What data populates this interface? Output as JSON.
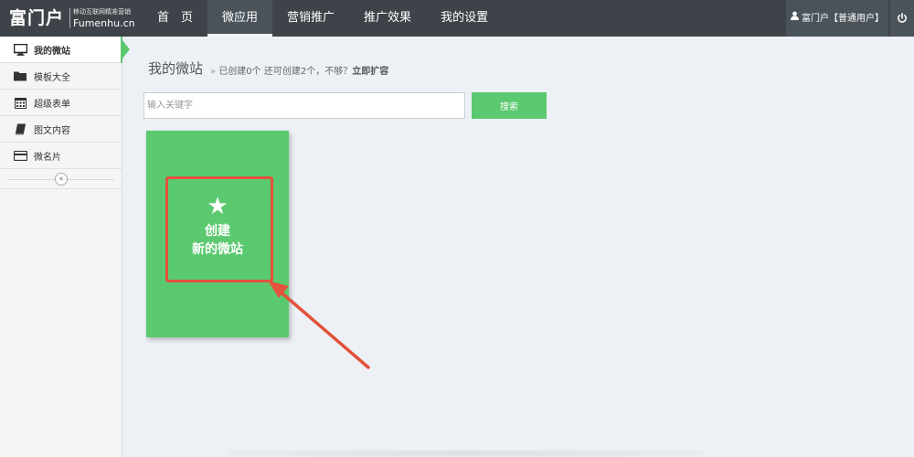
{
  "brand": {
    "name": "富门户",
    "tagline": "移动互联网精准营销",
    "domain": "Fumenhu.cn"
  },
  "nav": {
    "items": [
      {
        "label": "首　页",
        "active": false
      },
      {
        "label": "微应用",
        "active": true
      },
      {
        "label": "营销推广",
        "active": false
      },
      {
        "label": "推广效果",
        "active": false
      },
      {
        "label": "我的设置",
        "active": false
      }
    ]
  },
  "user": {
    "label": "富门户【普通用户】",
    "icon": "user-icon"
  },
  "power": {
    "icon": "power-icon"
  },
  "sidebar": {
    "items": [
      {
        "label": "我的微站",
        "icon": "monitor-icon",
        "active": true
      },
      {
        "label": "模板大全",
        "icon": "folder-icon",
        "active": false
      },
      {
        "label": "超级表单",
        "icon": "calendar-icon",
        "active": false
      },
      {
        "label": "图文内容",
        "icon": "book-icon",
        "active": false
      },
      {
        "label": "微名片",
        "icon": "card-icon",
        "active": false
      }
    ],
    "collapse": "«"
  },
  "main": {
    "title": "我的微站",
    "subtitle_arrow": "»",
    "subtitle": "已创建0个 还可创建2个，不够？",
    "expand_link": "立即扩容",
    "search": {
      "placeholder": "输入关键字",
      "value": "",
      "button": "搜索"
    },
    "create_card": {
      "icon": "star-icon",
      "star": "★",
      "line1": "创建",
      "line2": "新的微站"
    }
  },
  "colors": {
    "topbar": "#3d4349",
    "accent": "#5bc96f",
    "annotation": "#e2523c",
    "background": "#edf1f5"
  }
}
